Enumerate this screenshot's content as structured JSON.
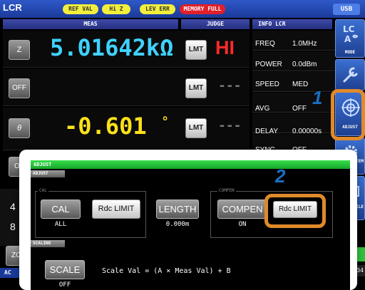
{
  "topbar": {
    "app_title": "LCR",
    "badges": [
      "REF VAL",
      "Hi Z",
      "LEV ERR",
      "MEMORY FULL"
    ],
    "usb_label": "USB"
  },
  "meas_header": "MEAS",
  "judge_header": "JUDGE",
  "info_header": "INFO LCR",
  "rows": [
    {
      "param": "Z",
      "value": "5.01642kΩ",
      "judge": "HI"
    },
    {
      "param": "OFF",
      "value": "",
      "judge": "---"
    },
    {
      "param": "θ",
      "value": "-0.601",
      "unit": "°",
      "judge": "---"
    },
    {
      "param": "OF",
      "value": ""
    }
  ],
  "lmt_label": "LMT",
  "info": [
    {
      "label": "FREQ",
      "value": "1.0MHz"
    },
    {
      "label": "POWER",
      "value": "0.0dBm"
    },
    {
      "label": "SPEED",
      "value": "MED"
    },
    {
      "label": "AVG",
      "value": "OFF"
    },
    {
      "label": "DELAY",
      "value": "0.00000s"
    },
    {
      "label": "SYNC",
      "value": "OFF"
    }
  ],
  "sidebar": {
    "mode_label": "MODE",
    "adjust_label": "ADJUST",
    "system_label": "STEM",
    "file_label": "ILE"
  },
  "bottom": {
    "left_a": "4",
    "left_b": "8",
    "zo_label": "ZO",
    "ac_label": "AC",
    "time_fragment": "8:34"
  },
  "callouts": {
    "one": "1",
    "two": "2"
  },
  "dialog": {
    "title": "ADJUST",
    "section_adjust": "ADJUST",
    "cal_group_label": "CAL",
    "compen_group_label": "COMPEN",
    "cal_button": "CAL",
    "cal_value": "ALL",
    "rdc_limit_left": "Rdc LIMIT",
    "length_button": "LENGTH",
    "length_value": "0.000m",
    "compen_button": "COMPEN",
    "compen_value": "ON",
    "rdc_limit_right": "Rdc LIMIT",
    "section_scaling": "SCALING",
    "scale_button": "SCALE",
    "scale_value": "OFF",
    "scale_formula": "Scale Val = (A × Meas Val) + B"
  },
  "colors": {
    "accent_orange": "#e08a2a",
    "callout_blue": "#1a6fc2",
    "value_cyan": "#3fd2ff",
    "value_yellow": "#ffe21a",
    "judge_red": "#ff2a2a",
    "dialog_green": "#22c23a"
  }
}
